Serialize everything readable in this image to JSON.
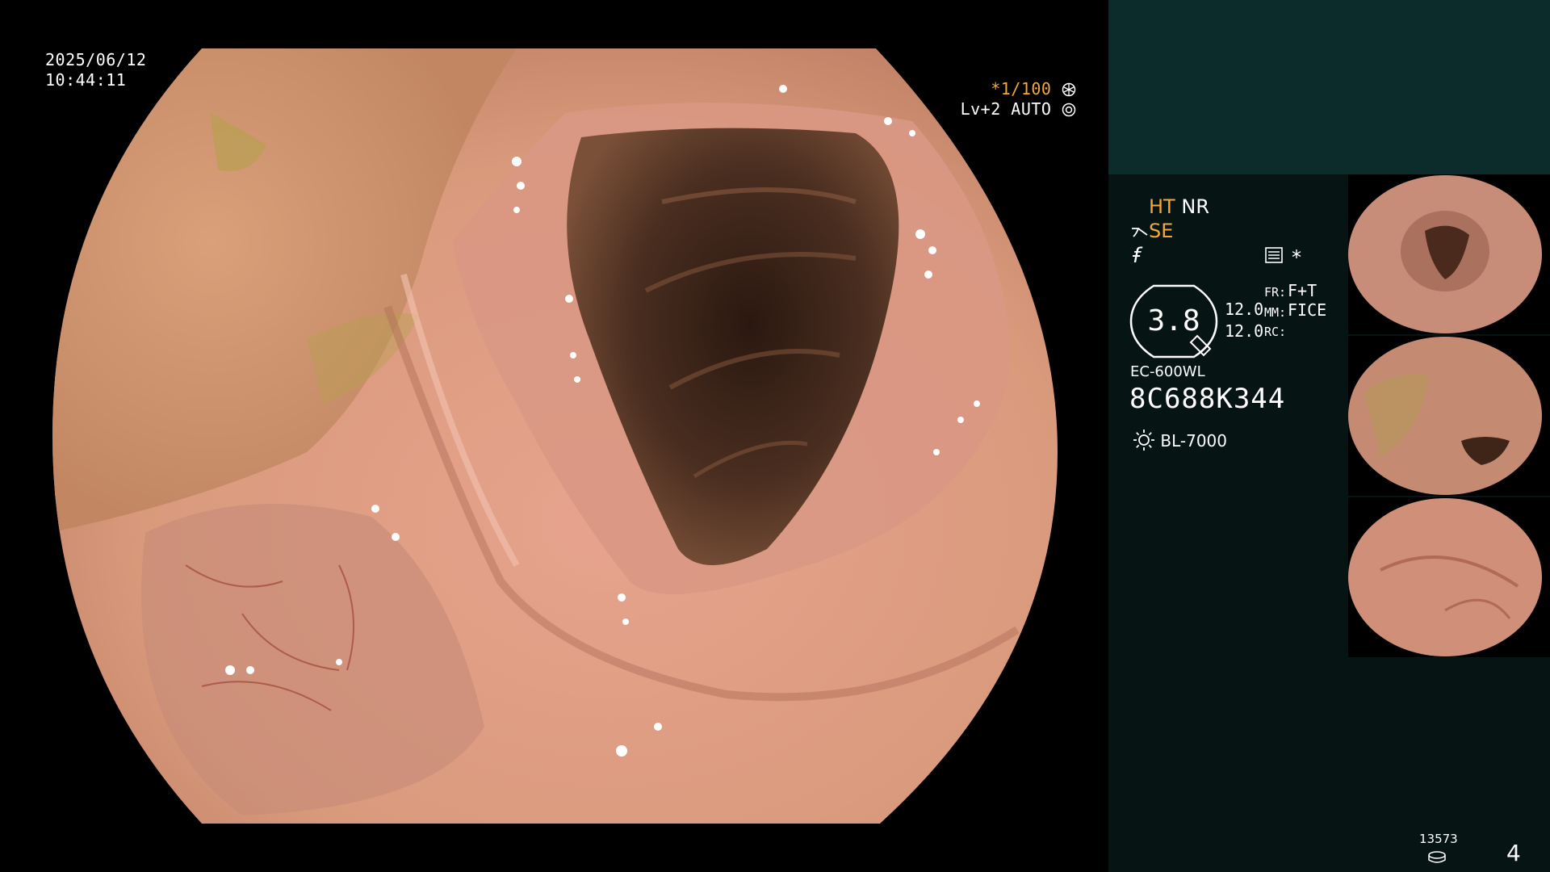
{
  "overlay": {
    "date": "2025/06/12",
    "time": "10:44:11",
    "shutter": "*1/100",
    "level": "Lv+2 AUTO"
  },
  "settings": {
    "ht": "HT",
    "nr": "NR",
    "se": "SE",
    "f_symbol": "f",
    "asterisk": "*",
    "gauge_value": "3.8",
    "val_1": "12.0",
    "val_2": "12.0",
    "fr_label": "FR:",
    "fr_value": "F+T",
    "mm_label": "MM:",
    "mm_value": "FICE",
    "rc_label": "RC:",
    "scope_model": "EC-600WL",
    "serial": "8C688K344",
    "light_source": "BL-7000"
  },
  "footer": {
    "image_count": "13573",
    "page_number": "4"
  },
  "colors": {
    "accent_orange": "#f0a93a",
    "panel_header": "#0c2b2b",
    "panel_body": "#071414"
  },
  "icons": [
    "sun-icon",
    "menu-icon",
    "counter-icon",
    "aperture-icon",
    "shutter-icon"
  ]
}
